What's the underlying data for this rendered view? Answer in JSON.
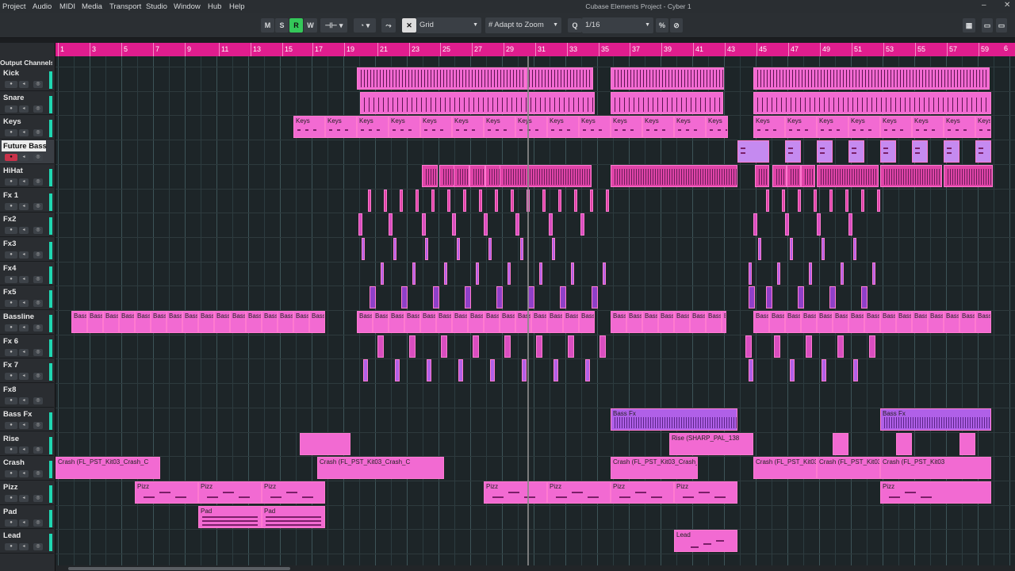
{
  "menubar": {
    "items": [
      "Project",
      "Audio",
      "MIDI",
      "Media",
      "Transport",
      "Studio",
      "Window",
      "Hub",
      "Help"
    ],
    "title": "Cubase Elements Project - Cyber 1"
  },
  "toolbar": {
    "btn_m": "M",
    "btn_s": "S",
    "btn_r": "R",
    "btn_w": "W",
    "snap_type": "Grid",
    "grid_mode": "Adapt to Zoom",
    "quantize": "1/16",
    "accent_color": "#e01d8e",
    "record_active_color": "#34c759"
  },
  "ruler": {
    "bars": [
      "1",
      "3",
      "5",
      "7",
      "9",
      "11",
      "13",
      "15",
      "17",
      "19",
      "21",
      "23",
      "25",
      "27",
      "29",
      "31",
      "33",
      "35",
      "37",
      "39",
      "41",
      "43",
      "45",
      "47",
      "49",
      "51",
      "53",
      "55",
      "57",
      "59",
      "6"
    ]
  },
  "output_channels": "Output Channels",
  "tracks": [
    {
      "name": "Kick"
    },
    {
      "name": "Snare"
    },
    {
      "name": "Keys"
    },
    {
      "name": "Future Bass"
    },
    {
      "name": "HiHat"
    },
    {
      "name": "Fx 1"
    },
    {
      "name": "Fx2"
    },
    {
      "name": "Fx3"
    },
    {
      "name": "Fx4"
    },
    {
      "name": "Fx5"
    },
    {
      "name": "Bassline"
    },
    {
      "name": "Fx 6"
    },
    {
      "name": "Fx 7"
    },
    {
      "name": "Fx8"
    },
    {
      "name": "Bass Fx"
    },
    {
      "name": "Rise"
    },
    {
      "name": "Crash"
    },
    {
      "name": "Pizz"
    },
    {
      "name": "Pad"
    },
    {
      "name": "Lead"
    }
  ],
  "parts": {
    "keys": "Keys",
    "bass": "Bass",
    "bass_fx": "Bass Fx",
    "rise": "Rise (SHARP_PAL_138",
    "crash": "Crash (FL_PST_Kit03_Crash_C",
    "crash2": "Crash (FL_PST_Kit03_Crash_C",
    "crash3": "Crash (FL_PST_Kit03",
    "crash4": "Crash (FL_PST_Kit03",
    "crash5": "Crash (FL_PST_Kit03",
    "pizz": "Pizz",
    "pad": "Pad",
    "lead": "Lead"
  },
  "colors": {
    "part_pink": "#f26ad2",
    "part_pink_dark": "#d94ec0",
    "part_magenta": "#e044a8",
    "part_violet": "#b060e8",
    "part_lilac": "#c58af0",
    "part_purple_dark": "#8f40c8",
    "ruler": "#e01d8e"
  }
}
